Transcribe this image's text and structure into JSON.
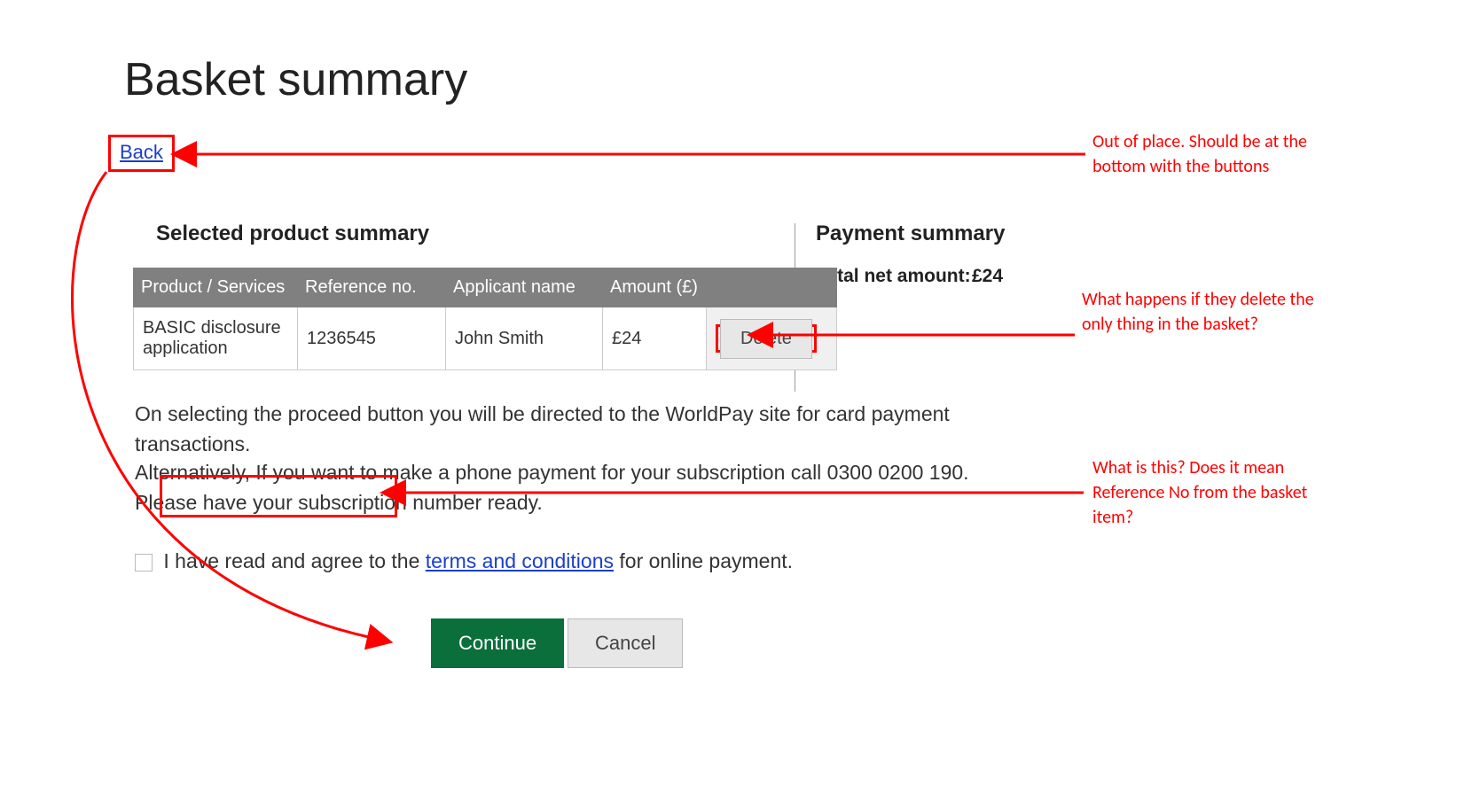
{
  "page_title": "Basket summary",
  "back_label": "Back",
  "product_summary_heading": "Selected product summary",
  "payment_summary_heading": "Payment summary",
  "total_label": "Total net amount:",
  "total_amount": "£24",
  "table": {
    "headers": {
      "c1": "Product / Services",
      "c2": "Reference no.",
      "c3": "Applicant name",
      "c4": "Amount (£)"
    },
    "row": {
      "product": "BASIC disclosure application",
      "reference": "1236545",
      "name": "John Smith",
      "amount": "£24",
      "delete_label": "Delete"
    }
  },
  "info_line1": "On selecting the proceed button you will be directed to the WorldPay site for card payment transactions.",
  "info_line2": "Alternatively, If you want to make a phone payment for your subscription call 0300 0200 190. Please have your subscription number ready.",
  "terms": {
    "prefix": "I have read and agree to the ",
    "link": "terms and conditions",
    "suffix": " for online payment."
  },
  "buttons": {
    "continue": "Continue",
    "cancel": "Cancel"
  },
  "annotations": {
    "back_note": "Out of place. Should be at the bottom with the buttons",
    "delete_note": "What happens if they delete the only thing in the basket?",
    "subscription_note": "What is this? Does it mean Reference No from the basket item?"
  }
}
